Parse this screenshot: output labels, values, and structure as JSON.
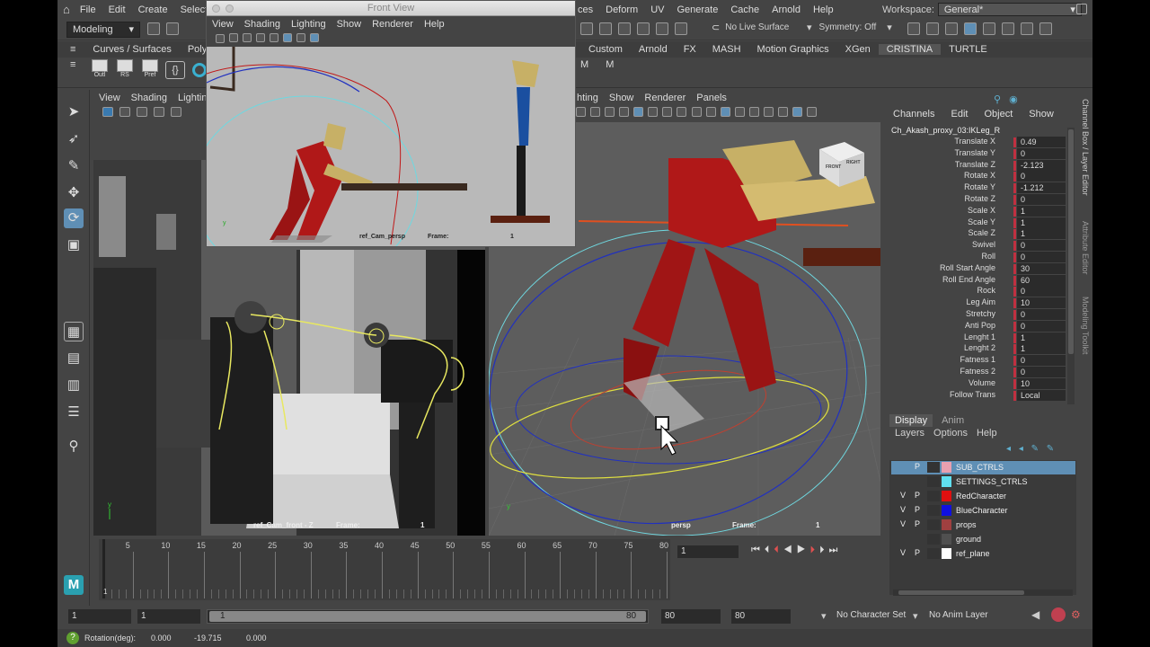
{
  "menubar": {
    "items_left": [
      "File",
      "Edit",
      "Create",
      "Select"
    ],
    "items_right": [
      "ces",
      "Deform",
      "UV",
      "Generate",
      "Cache",
      "Arnold",
      "Help"
    ],
    "workspace_label": "Workspace:",
    "workspace_value": "General*"
  },
  "toolbar": {
    "mode": "Modeling",
    "live_surface": "No Live Surface",
    "symmetry": "Symmetry: Off"
  },
  "shelf": {
    "tabs_left": [
      "Curves / Surfaces",
      "Poly Mo"
    ],
    "tabs_right": [
      "Custom",
      "Arnold",
      "FX",
      "MASH",
      "Motion Graphics",
      "XGen",
      "CRISTINA",
      "TURTLE"
    ],
    "buttons": [
      "Outl",
      "RS",
      "Pref"
    ]
  },
  "float_window": {
    "title": "Front View",
    "menu": [
      "View",
      "Shading",
      "Lighting",
      "Show",
      "Renderer",
      "Help"
    ],
    "cam_label": "ref_Cam_persp",
    "frame_label": "Frame:",
    "frame_value": "1"
  },
  "viewport_left": {
    "menu": [
      "View",
      "Shading",
      "Lighting"
    ],
    "cam_label": "ref_Cam_front - Z",
    "frame_label": "Frame:",
    "frame_value": "1"
  },
  "viewport_right": {
    "menu": [
      "hting",
      "Show",
      "Renderer",
      "Panels"
    ],
    "cam_label": "persp",
    "frame_label": "Frame:",
    "frame_value": "1",
    "cube_front": "FRONT",
    "cube_right": "RIGHT"
  },
  "channel_box": {
    "menu": [
      "Channels",
      "Edit",
      "Object",
      "Show"
    ],
    "object_name": "Ch_Akash_proxy_03:IKLeg_R",
    "channels": [
      {
        "name": "Translate X",
        "value": "0.49"
      },
      {
        "name": "Translate Y",
        "value": "0"
      },
      {
        "name": "Translate Z",
        "value": "-2.123"
      },
      {
        "name": "Rotate X",
        "value": "0"
      },
      {
        "name": "Rotate Y",
        "value": "-1.212"
      },
      {
        "name": "Rotate Z",
        "value": "0"
      },
      {
        "name": "Scale X",
        "value": "1"
      },
      {
        "name": "Scale Y",
        "value": "1"
      },
      {
        "name": "Scale Z",
        "value": "1"
      },
      {
        "name": "Swivel",
        "value": "0"
      },
      {
        "name": "Roll",
        "value": "0"
      },
      {
        "name": "Roll Start Angle",
        "value": "30"
      },
      {
        "name": "Roll End Angle",
        "value": "60"
      },
      {
        "name": "Rock",
        "value": "0"
      },
      {
        "name": "Leg Aim",
        "value": "10"
      },
      {
        "name": "Stretchy",
        "value": "0"
      },
      {
        "name": "Anti Pop",
        "value": "0"
      },
      {
        "name": "Lenght 1",
        "value": "1"
      },
      {
        "name": "Lenght 2",
        "value": "1"
      },
      {
        "name": "Fatness 1",
        "value": "0"
      },
      {
        "name": "Fatness 2",
        "value": "0"
      },
      {
        "name": "Volume",
        "value": "10"
      },
      {
        "name": "Follow Trans",
        "value": "Local"
      }
    ],
    "side_tabs": [
      "Channel Box / Layer Editor",
      "Attribute Editor",
      "Modeling Toolkit"
    ]
  },
  "layer_editor": {
    "tabs": [
      "Display",
      "Anim"
    ],
    "menu": [
      "Layers",
      "Options",
      "Help"
    ],
    "layers": [
      {
        "v": "",
        "p": "P",
        "color": "#e8a0b0",
        "name": "SUB_CTRLS",
        "selected": true
      },
      {
        "v": "",
        "p": "",
        "color": "#60e0f0",
        "name": "SETTINGS_CTRLS",
        "selected": false
      },
      {
        "v": "V",
        "p": "P",
        "color": "#e01010",
        "name": "RedCharacter",
        "selected": false
      },
      {
        "v": "V",
        "p": "P",
        "color": "#1010e0",
        "name": "BlueCharacter",
        "selected": false
      },
      {
        "v": "V",
        "p": "P",
        "color": "#a04040",
        "name": "props",
        "selected": false
      },
      {
        "v": "",
        "p": "",
        "color": "#505050",
        "name": "ground",
        "selected": false
      },
      {
        "v": "V",
        "p": "P",
        "color": "#ffffff",
        "name": "ref_plane",
        "selected": false
      }
    ]
  },
  "timeline": {
    "ticks": [
      "5",
      "10",
      "15",
      "20",
      "25",
      "30",
      "35",
      "40",
      "45",
      "50",
      "55",
      "60",
      "65",
      "70",
      "75",
      "80"
    ],
    "current_frame_marker": "1",
    "current_frame_field": "1"
  },
  "range": {
    "start": "1",
    "anim_start": "1",
    "slider_start": "1",
    "slider_end": "80",
    "anim_end": "80",
    "end": "80",
    "character_set": "No Character Set",
    "anim_layer": "No Anim Layer"
  },
  "helpline": {
    "text": "Rotation(deg):",
    "x": "0.000",
    "y": "-19.715",
    "z": "0.000"
  },
  "colors": {
    "bg": "#444444",
    "field": "#2b2b2b",
    "red_char": "#b01818",
    "blue_char": "#1a4fa0",
    "selected_layer": "#5f8fb5"
  }
}
